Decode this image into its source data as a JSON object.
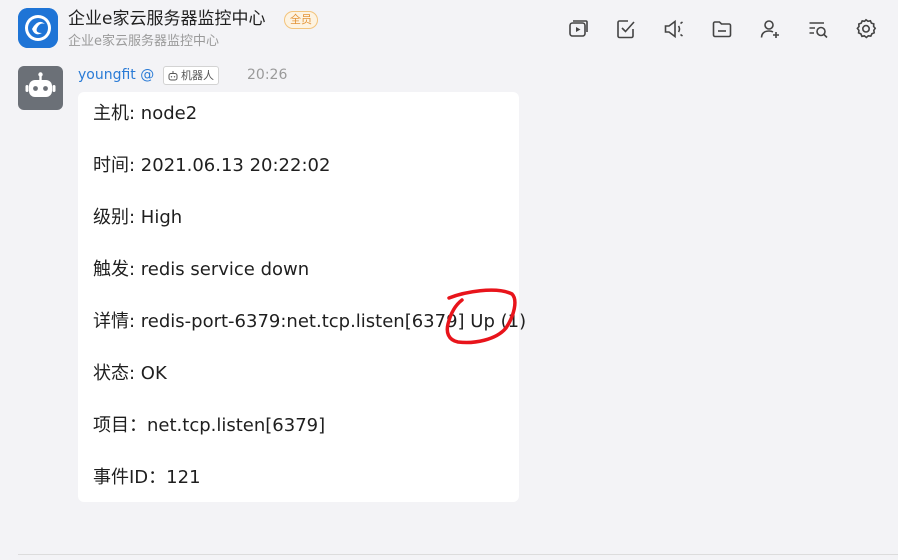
{
  "header": {
    "title": "企业e家云服务器监控中心",
    "badge": "全员",
    "subtitle": "企业e家云服务器监控中心",
    "toolbar": [
      {
        "icon": "video-icon"
      },
      {
        "icon": "task-check-icon"
      },
      {
        "icon": "announcement-icon"
      },
      {
        "icon": "folder-icon"
      },
      {
        "icon": "add-member-icon"
      },
      {
        "icon": "search-history-icon"
      },
      {
        "icon": "settings-icon"
      }
    ]
  },
  "message": {
    "sender": "youngfit @",
    "bot_tag": "机器人",
    "time": "20:26",
    "lines": [
      "主机: node2",
      "时间: 2021.06.13 20:22:02",
      "级别: High",
      "触发: redis service down",
      "详情: redis-port-6379:net.tcp.listen[6379] Up (1)",
      "状态: OK",
      "项目：net.tcp.listen[6379]",
      "事件ID：121"
    ]
  },
  "colors": {
    "background": "#f3f3f6",
    "sender_link": "#2a7bd6",
    "badge_text": "#e3953a",
    "annotation": "#e8141b"
  }
}
